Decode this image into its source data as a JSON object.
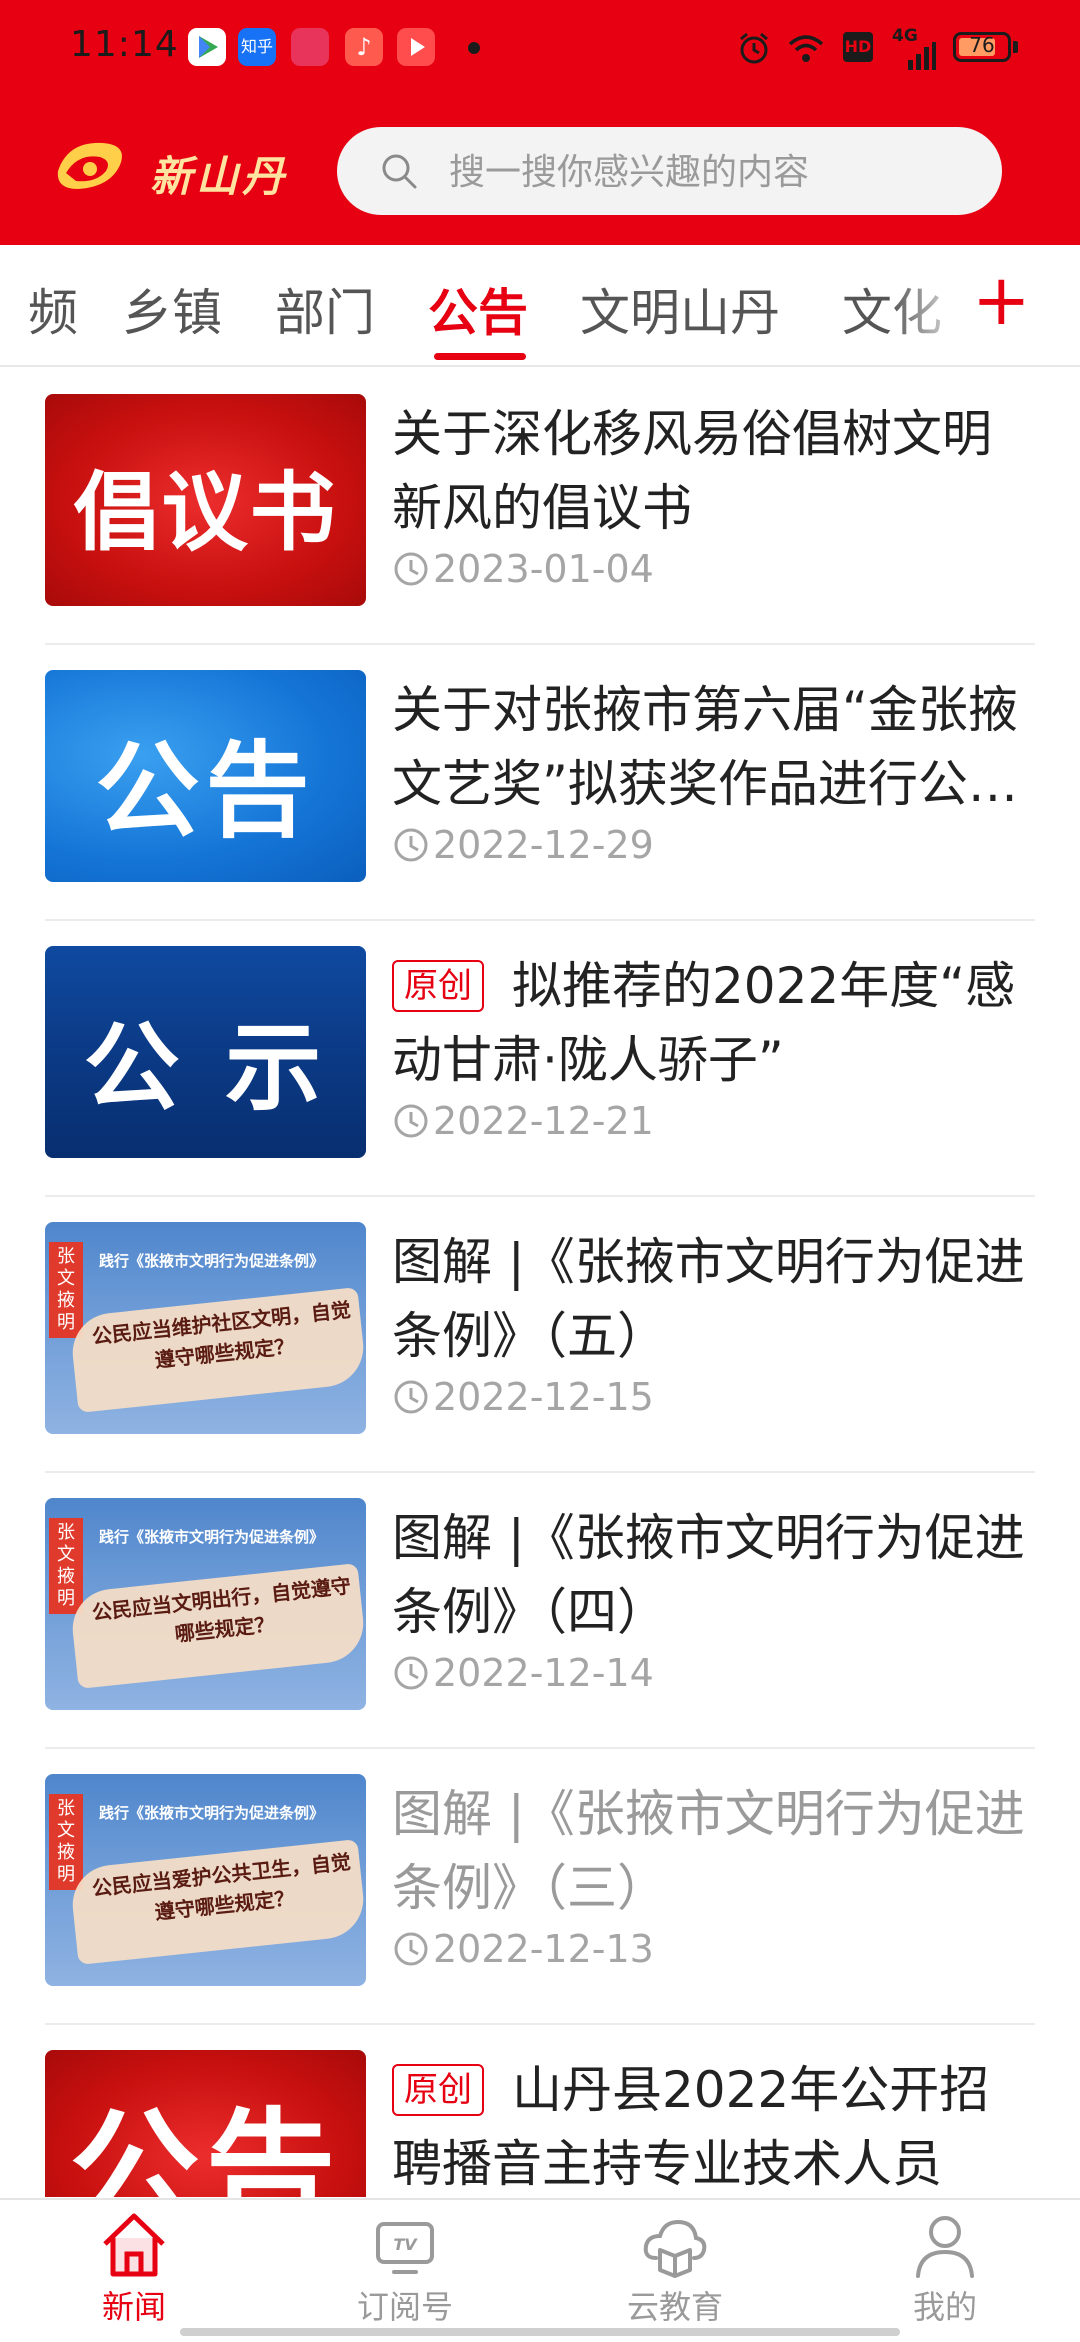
{
  "status_bar": {
    "time": "11:14",
    "network": "4G",
    "hd": "HD",
    "battery": "76",
    "app_icons": [
      "play-store-icon",
      "zhihu-icon",
      "pinduoduo-icon",
      "music-icon",
      "video-icon"
    ]
  },
  "header": {
    "logo_text": "新山丹",
    "search_placeholder": "搜一搜你感兴趣的内容"
  },
  "tabs": {
    "items": [
      {
        "label": "频",
        "active": false
      },
      {
        "label": "乡镇",
        "active": false
      },
      {
        "label": "部门",
        "active": false
      },
      {
        "label": "公告",
        "active": true
      },
      {
        "label": "文明山丹",
        "active": false
      },
      {
        "label": "文化",
        "active": false
      }
    ],
    "add_label": "+"
  },
  "news": [
    {
      "title": "关于深化移风易俗倡树文明新风的倡议书",
      "date": "2023-01-04",
      "tag": "",
      "thumb_text": "倡议书",
      "read": false
    },
    {
      "title": "关于对张掖市第六届“金张掖文艺奖”拟获奖作品进行公示的公告",
      "date": "2022-12-29",
      "tag": "",
      "thumb_text": "公告",
      "read": false
    },
    {
      "title": "拟推荐的2022年度“感动甘肃·陇人骄子”",
      "date": "2022-12-21",
      "tag": "原创",
      "thumb_text": "公 示",
      "read": false
    },
    {
      "title": "图解 |《张掖市文明行为促进条例》（五）",
      "date": "2022-12-15",
      "tag": "",
      "thumb_badge": "张文掖明",
      "thumb_top": "践行《张掖市文明行为促进条例》",
      "thumb_text": "公民应当维护社区文明，自觉遵守哪些规定？",
      "read": false
    },
    {
      "title": "图解 |《张掖市文明行为促进条例》（四）",
      "date": "2022-12-14",
      "tag": "",
      "thumb_badge": "张文掖明",
      "thumb_top": "践行《张掖市文明行为促进条例》",
      "thumb_text": "公民应当文明出行，自觉遵守哪些规定？",
      "read": false
    },
    {
      "title": "图解 |《张掖市文明行为促进条例》（三）",
      "date": "2022-12-13",
      "tag": "",
      "thumb_badge": "张文掖明",
      "thumb_top": "践行《张掖市文明行为促进条例》",
      "thumb_text": "公民应当爱护公共卫生，自觉遵守哪些规定？",
      "read": true
    },
    {
      "title": "山丹县2022年公开招聘播音主持专业技术人员",
      "date": "",
      "tag": "原创",
      "thumb_text": "公告",
      "read": false
    }
  ],
  "bottom_nav": [
    {
      "label": "新闻",
      "icon": "home-icon",
      "active": true
    },
    {
      "label": "订阅号",
      "icon": "tv-icon",
      "active": false
    },
    {
      "label": "云教育",
      "icon": "cloud-book-icon",
      "active": false
    },
    {
      "label": "我的",
      "icon": "person-icon",
      "active": false
    }
  ],
  "colors": {
    "brand_red": "#e60012",
    "text": "#222222",
    "muted": "#a5a5a5"
  }
}
